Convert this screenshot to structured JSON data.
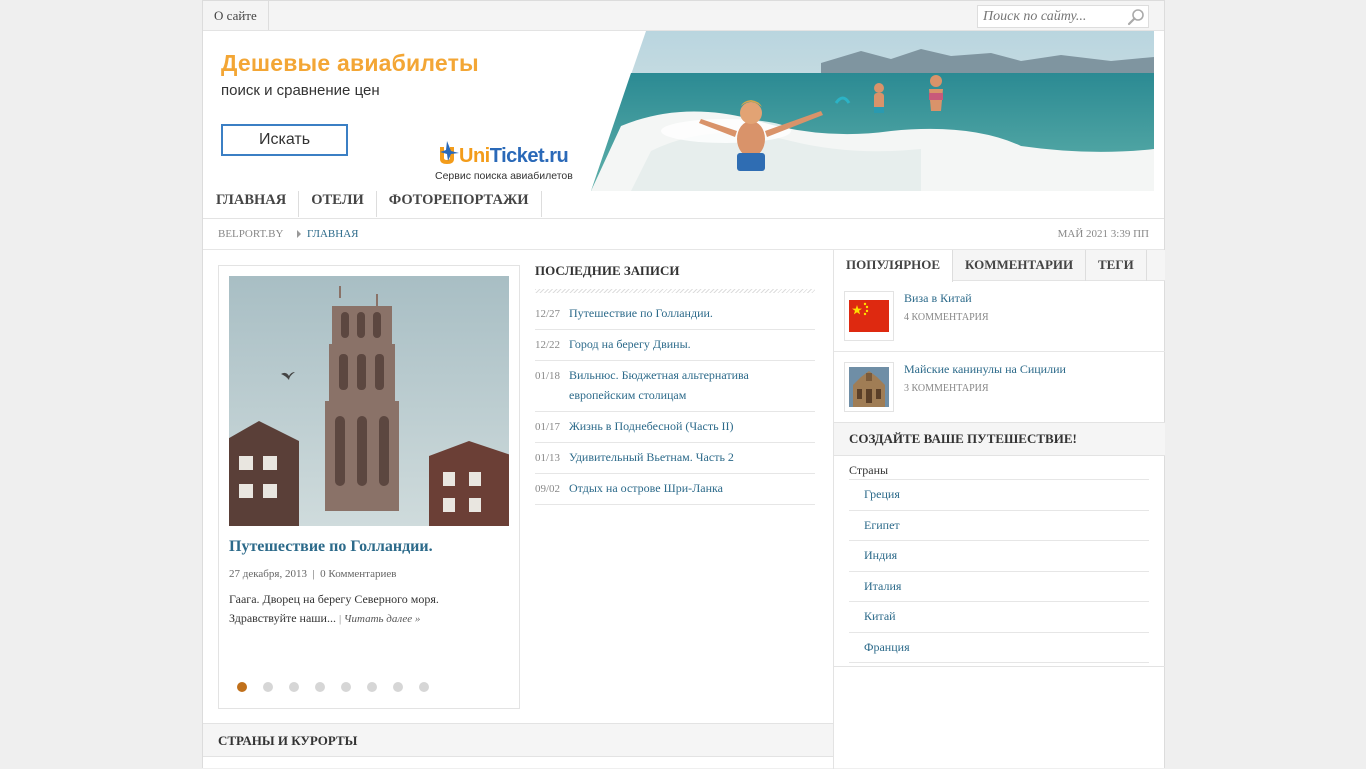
{
  "topbar": {
    "about_label": "О сайте",
    "search_placeholder": "Поиск по сайту...",
    "search_icon": "magnifier-icon"
  },
  "banner": {
    "headline": "Дешевые авиабилеты",
    "subline": "поиск и сравнение цен",
    "button_label": "Искать",
    "logo_name_part1": "Uni",
    "logo_name_part2": "Ticket.ru",
    "logo_tagline": "Сервис поиска авиабилетов"
  },
  "nav": {
    "items": [
      "ГЛАВНАЯ",
      "ОТЕЛИ",
      "ФОТОРЕПОРТАЖИ"
    ]
  },
  "breadcrumb": {
    "site": "BELPORT.BY",
    "current": "ГЛАВНАЯ",
    "datetime": "МАЙ 2021 3:39 ПП"
  },
  "featured": {
    "title": "Путешествие по Голландии.",
    "date": "27 декабря, 2013",
    "separator": "|",
    "comments": "0 Комментариев",
    "excerpt": "Гаага. Дворец на берегу Северного моря. Здравствуйте наши...",
    "read_more": "Читать далее »",
    "slides_total": 8,
    "active_slide": 1
  },
  "recent": {
    "heading": "ПОСЛЕДНИЕ ЗАПИСИ",
    "posts": [
      {
        "date": "12/27",
        "title": "Путешествие по Голландии."
      },
      {
        "date": "12/22",
        "title": "Город на берегу Двины."
      },
      {
        "date": "01/18",
        "title": "Вильнюс. Бюджетная альтернатива европейским столицам"
      },
      {
        "date": "01/17",
        "title": "Жизнь в Поднебесной (Часть II)"
      },
      {
        "date": "01/13",
        "title": "Удивительный Вьетнам. Часть 2"
      },
      {
        "date": "09/02",
        "title": "Отдых на острове Шри-Ланка"
      }
    ]
  },
  "sidebar": {
    "tabs": [
      "ПОПУЛЯРНОЕ",
      "КОММЕНТАРИИ",
      "ТЕГИ"
    ],
    "popular": [
      {
        "title": "Виза в Китай",
        "comments": "4 КОММЕНТАРИЯ"
      },
      {
        "title": "Майские канинулы на Сицилии",
        "comments": "3 КОММЕНТАРИЯ"
      }
    ],
    "create_heading": "СОЗДАЙТЕ ВАШЕ ПУТЕШЕСТВИЕ!",
    "countries_label": "Страны",
    "countries": [
      "Греция",
      "Египет",
      "Индия",
      "Италия",
      "Китай",
      "Франция"
    ]
  },
  "resorts": {
    "heading": "СТРАНЫ И КУРОРТЫ"
  },
  "colors": {
    "link": "#2c6a8a",
    "accent_orange": "#c0701b",
    "banner_orange": "#f3a635",
    "banner_blue": "#3b7fc4"
  }
}
